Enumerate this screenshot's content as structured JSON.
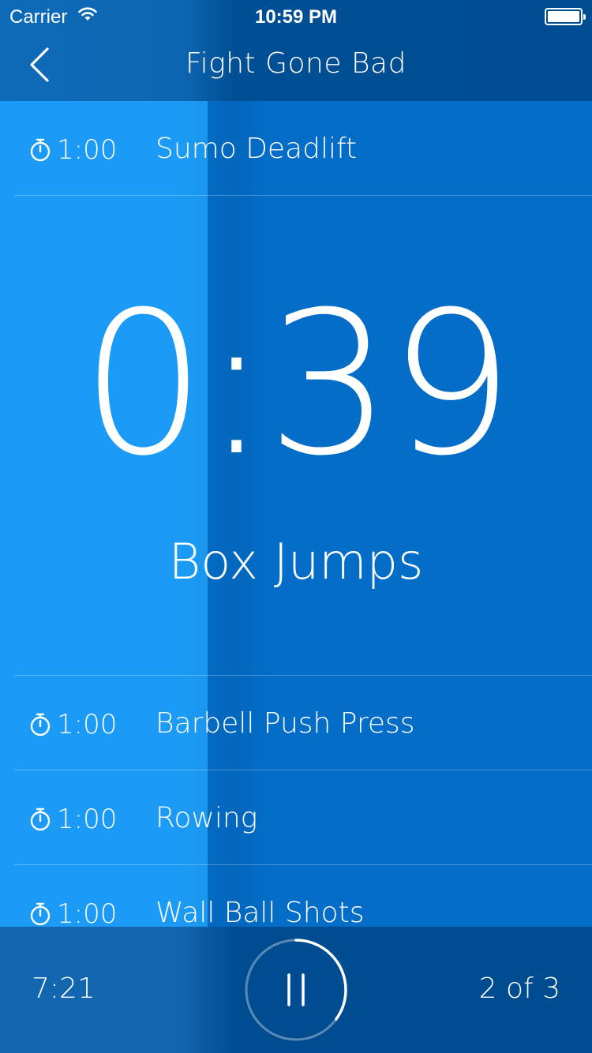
{
  "status_bar": {
    "carrier": "Carrier",
    "time": "10:59 PM"
  },
  "nav": {
    "title": "Fight Gone Bad",
    "back_icon": "chevron-left-icon"
  },
  "previous_exercise": {
    "duration": "1:00",
    "name": "Sumo Deadlift"
  },
  "current": {
    "remaining": "0:39",
    "name": "Box Jumps"
  },
  "upcoming": [
    {
      "duration": "1:00",
      "name": "Barbell Push Press"
    },
    {
      "duration": "1:00",
      "name": "Rowing"
    },
    {
      "duration": "1:00",
      "name": "Wall Ball Shots"
    }
  ],
  "footer": {
    "total_time": "7:21",
    "round_progress": "2 of 3",
    "pause_icon": "pause-icon",
    "ring_progress_fraction": 0.35
  },
  "colors": {
    "light_blue": "#1b9bf5",
    "dark_blue": "#036dc8",
    "header": "#004d92"
  }
}
